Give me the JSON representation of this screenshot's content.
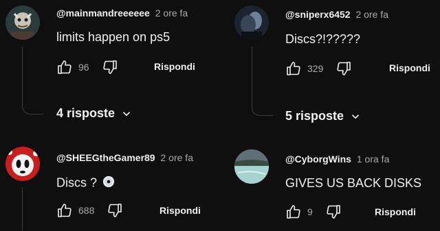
{
  "comments": [
    {
      "user": "@mainmandreeeeee",
      "time": "2 ore fa",
      "text": "limits happen on ps5",
      "likes": "96",
      "reply_label": "Rispondi",
      "replies_label": "4 risposte"
    },
    {
      "user": "@sniperx6452",
      "time": "2 ore fa",
      "text": "Discs?!?????",
      "likes": "329",
      "reply_label": "Rispondi",
      "replies_label": "5 risposte"
    },
    {
      "user": "@SHEEGtheGamer89",
      "time": "2 ore fa",
      "text": "Discs ?",
      "likes": "688",
      "reply_label": "Rispondi"
    },
    {
      "user": "@CyborgWins",
      "time": "1 ora fa",
      "text": "GIVES US BACK DISKS",
      "likes": "9",
      "reply_label": "Rispondi"
    }
  ],
  "icons": {
    "like": "thumbs-up-icon",
    "dislike": "thumbs-down-icon",
    "expand": "chevron-down-icon",
    "emoji": "optical-disc-emoji"
  },
  "colors": {
    "background": "#0f0f0f",
    "text": "#f1f1f1",
    "secondary": "#aaaaaa"
  }
}
